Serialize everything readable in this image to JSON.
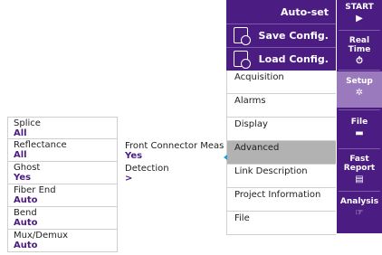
{
  "params": [
    {
      "label": "Splice",
      "value": "All"
    },
    {
      "label": "Reflectance",
      "value": "All"
    },
    {
      "label": "Ghost",
      "value": "Yes"
    },
    {
      "label": "Fiber End",
      "value": "Auto"
    },
    {
      "label": "Bend",
      "value": "Auto"
    },
    {
      "label": "Mux/Demux",
      "value": "Auto"
    }
  ],
  "middle": [
    {
      "label": "Front Connector Meas",
      "value": "Yes"
    },
    {
      "label": "Detection",
      "value": ">"
    }
  ],
  "config_menu": {
    "autoset": "Auto-set",
    "save": "Save Config.",
    "load": "Load Config."
  },
  "setup_list": [
    "Acquisition",
    "Alarms",
    "Display",
    "Advanced",
    "Link Description",
    "Project Information",
    "File"
  ],
  "selected_item": "Advanced",
  "sidebar": {
    "start": "START",
    "realtime_1": "Real",
    "realtime_2": "Time",
    "setup": "Setup",
    "file": "File",
    "report_1": "Fast",
    "report_2": "Report",
    "analysis": "Analysis"
  },
  "colors": {
    "accent": "#4b1c82",
    "active": "#9b79bd",
    "selected_row": "#b2b2b2"
  },
  "icons": {
    "save": "save-config-icon",
    "load": "load-config-icon",
    "start": "play-icon",
    "realtime": "timer-icon",
    "setup": "gear-icon",
    "file": "folder-icon",
    "report": "report-icon",
    "analysis": "analysis-icon"
  }
}
